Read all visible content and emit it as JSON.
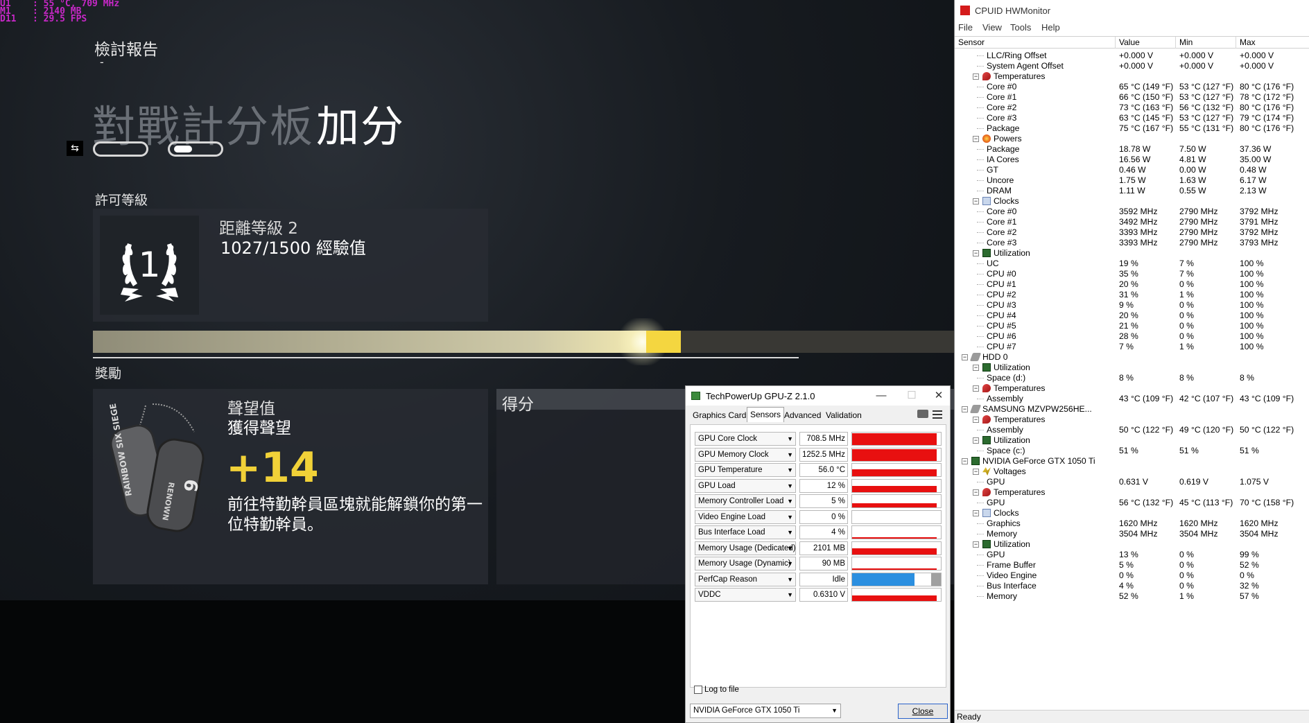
{
  "osd": {
    "lines": [
      "U1    : 55 °C, 709 MHz",
      "M1    : 2140 MB",
      "D11   : 29.5 FPS"
    ]
  },
  "game": {
    "report_title": "檢討報告",
    "report_dash": "-",
    "board_title": "對戰計分板",
    "board_bonus": "加分",
    "license_label": "許可等級",
    "license_level": "1",
    "license_distance": "距離等級 2",
    "license_xp": "1027/1500 經驗值",
    "xp_progress": 0.6827,
    "rewards_label": "獎勵",
    "renown_title": "聲望值",
    "renown_sub": "獲得聲望",
    "renown_value": "+14",
    "renown_desc": "前往特勤幹員區塊就能解鎖你的第一位特勤幹員。",
    "score_label": "得分",
    "accent_color": "#f1d138"
  },
  "gpuz": {
    "title": "TechPowerUp GPU-Z 2.1.0",
    "tabs": [
      "Graphics Card",
      "Sensors",
      "Advanced",
      "Validation"
    ],
    "active_tab": "Sensors",
    "sensors": [
      {
        "name": "GPU Core Clock",
        "value": "708.5 MHz",
        "level": 0.95
      },
      {
        "name": "GPU Memory Clock",
        "value": "1252.5 MHz",
        "level": 0.95
      },
      {
        "name": "GPU Temperature",
        "value": "56.0 °C",
        "level": 0.55
      },
      {
        "name": "GPU Load",
        "value": "12 %",
        "level": 0.5
      },
      {
        "name": "Memory Controller Load",
        "value": "5 %",
        "level": 0.35
      },
      {
        "name": "Video Engine Load",
        "value": "0 %",
        "level": 0.0
      },
      {
        "name": "Bus Interface Load",
        "value": "4 %",
        "level": 0.08
      },
      {
        "name": "Memory Usage (Dedicated)",
        "value": "2101 MB",
        "level": 0.5
      },
      {
        "name": "Memory Usage (Dynamic)",
        "value": "90 MB",
        "level": 0.1
      },
      {
        "name": "PerfCap Reason",
        "value": "Idle",
        "level": 1.0,
        "color": "blue"
      },
      {
        "name": "VDDC",
        "value": "0.6310 V",
        "level": 0.45
      }
    ],
    "log_label": "Log to file",
    "gpu_select": "NVIDIA GeForce GTX 1050 Ti",
    "close_label": "Close"
  },
  "hwm": {
    "title": "CPUID HWMonitor",
    "menu": [
      "File",
      "View",
      "Tools",
      "Help"
    ],
    "columns": [
      "Sensor",
      "Value",
      "Min",
      "Max"
    ],
    "status": "Ready",
    "rows": [
      {
        "level": 3,
        "name": "LLC/Ring Offset",
        "v": "+0.000 V",
        "min": "+0.000 V",
        "max": "+0.000 V"
      },
      {
        "level": 3,
        "name": "System Agent Offset",
        "v": "+0.000 V",
        "min": "+0.000 V",
        "max": "+0.000 V"
      },
      {
        "level": 2,
        "name": "Temperatures",
        "icon": "temp"
      },
      {
        "level": 3,
        "name": "Core #0",
        "v": "65 °C  (149 °F)",
        "min": "53 °C  (127 °F)",
        "max": "80 °C  (176 °F)"
      },
      {
        "level": 3,
        "name": "Core #1",
        "v": "66 °C  (150 °F)",
        "min": "53 °C  (127 °F)",
        "max": "78 °C  (172 °F)"
      },
      {
        "level": 3,
        "name": "Core #2",
        "v": "73 °C  (163 °F)",
        "min": "56 °C  (132 °F)",
        "max": "80 °C  (176 °F)"
      },
      {
        "level": 3,
        "name": "Core #3",
        "v": "63 °C  (145 °F)",
        "min": "53 °C  (127 °F)",
        "max": "79 °C  (174 °F)"
      },
      {
        "level": 3,
        "name": "Package",
        "v": "75 °C  (167 °F)",
        "min": "55 °C  (131 °F)",
        "max": "80 °C  (176 °F)"
      },
      {
        "level": 2,
        "name": "Powers",
        "icon": "power"
      },
      {
        "level": 3,
        "name": "Package",
        "v": "18.78 W",
        "min": "7.50 W",
        "max": "37.36 W"
      },
      {
        "level": 3,
        "name": "IA Cores",
        "v": "16.56 W",
        "min": "4.81 W",
        "max": "35.00 W"
      },
      {
        "level": 3,
        "name": "GT",
        "v": "0.46 W",
        "min": "0.00 W",
        "max": "0.48 W"
      },
      {
        "level": 3,
        "name": "Uncore",
        "v": "1.75 W",
        "min": "1.63 W",
        "max": "6.17 W"
      },
      {
        "level": 3,
        "name": "DRAM",
        "v": "1.11 W",
        "min": "0.55 W",
        "max": "2.13 W"
      },
      {
        "level": 2,
        "name": "Clocks",
        "icon": "clock"
      },
      {
        "level": 3,
        "name": "Core #0",
        "v": "3592 MHz",
        "min": "2790 MHz",
        "max": "3792 MHz"
      },
      {
        "level": 3,
        "name": "Core #1",
        "v": "3492 MHz",
        "min": "2790 MHz",
        "max": "3791 MHz"
      },
      {
        "level": 3,
        "name": "Core #2",
        "v": "3393 MHz",
        "min": "2790 MHz",
        "max": "3792 MHz"
      },
      {
        "level": 3,
        "name": "Core #3",
        "v": "3393 MHz",
        "min": "2790 MHz",
        "max": "3793 MHz"
      },
      {
        "level": 2,
        "name": "Utilization",
        "icon": "util"
      },
      {
        "level": 3,
        "name": "UC",
        "v": "19 %",
        "min": "7 %",
        "max": "100 %"
      },
      {
        "level": 3,
        "name": "CPU #0",
        "v": "35 %",
        "min": "7 %",
        "max": "100 %"
      },
      {
        "level": 3,
        "name": "CPU #1",
        "v": "20 %",
        "min": "0 %",
        "max": "100 %"
      },
      {
        "level": 3,
        "name": "CPU #2",
        "v": "31 %",
        "min": "1 %",
        "max": "100 %"
      },
      {
        "level": 3,
        "name": "CPU #3",
        "v": "9 %",
        "min": "0 %",
        "max": "100 %"
      },
      {
        "level": 3,
        "name": "CPU #4",
        "v": "20 %",
        "min": "0 %",
        "max": "100 %"
      },
      {
        "level": 3,
        "name": "CPU #5",
        "v": "21 %",
        "min": "0 %",
        "max": "100 %"
      },
      {
        "level": 3,
        "name": "CPU #6",
        "v": "28 %",
        "min": "0 %",
        "max": "100 %"
      },
      {
        "level": 3,
        "name": "CPU #7",
        "v": "7 %",
        "min": "1 %",
        "max": "100 %"
      },
      {
        "level": 1,
        "name": "HDD 0",
        "icon": "disk"
      },
      {
        "level": 2,
        "name": "Utilization",
        "icon": "util"
      },
      {
        "level": 3,
        "name": "Space (d:)",
        "v": "8 %",
        "min": "8 %",
        "max": "8 %"
      },
      {
        "level": 2,
        "name": "Temperatures",
        "icon": "temp"
      },
      {
        "level": 3,
        "name": "Assembly",
        "v": "43 °C  (109 °F)",
        "min": "42 °C  (107 °F)",
        "max": "43 °C  (109 °F)"
      },
      {
        "level": 1,
        "name": "SAMSUNG MZVPW256HE...",
        "icon": "disk"
      },
      {
        "level": 2,
        "name": "Temperatures",
        "icon": "temp"
      },
      {
        "level": 3,
        "name": "Assembly",
        "v": "50 °C  (122 °F)",
        "min": "49 °C  (120 °F)",
        "max": "50 °C  (122 °F)"
      },
      {
        "level": 2,
        "name": "Utilization",
        "icon": "util"
      },
      {
        "level": 3,
        "name": "Space (c:)",
        "v": "51 %",
        "min": "51 %",
        "max": "51 %"
      },
      {
        "level": 1,
        "name": "NVIDIA GeForce GTX 1050 Ti",
        "icon": "gpu"
      },
      {
        "level": 2,
        "name": "Voltages",
        "icon": "volt"
      },
      {
        "level": 3,
        "name": "GPU",
        "v": "0.631 V",
        "min": "0.619 V",
        "max": "1.075 V"
      },
      {
        "level": 2,
        "name": "Temperatures",
        "icon": "temp"
      },
      {
        "level": 3,
        "name": "GPU",
        "v": "56 °C  (132 °F)",
        "min": "45 °C  (113 °F)",
        "max": "70 °C  (158 °F)"
      },
      {
        "level": 2,
        "name": "Clocks",
        "icon": "clock"
      },
      {
        "level": 3,
        "name": "Graphics",
        "v": "1620 MHz",
        "min": "1620 MHz",
        "max": "1620 MHz"
      },
      {
        "level": 3,
        "name": "Memory",
        "v": "3504 MHz",
        "min": "3504 MHz",
        "max": "3504 MHz"
      },
      {
        "level": 2,
        "name": "Utilization",
        "icon": "util"
      },
      {
        "level": 3,
        "name": "GPU",
        "v": "13 %",
        "min": "0 %",
        "max": "99 %"
      },
      {
        "level": 3,
        "name": "Frame Buffer",
        "v": "5 %",
        "min": "0 %",
        "max": "52 %"
      },
      {
        "level": 3,
        "name": "Video Engine",
        "v": "0 %",
        "min": "0 %",
        "max": "0 %"
      },
      {
        "level": 3,
        "name": "Bus Interface",
        "v": "4 %",
        "min": "0 %",
        "max": "32 %"
      },
      {
        "level": 3,
        "name": "Memory",
        "v": "52 %",
        "min": "1 %",
        "max": "57 %"
      }
    ]
  }
}
